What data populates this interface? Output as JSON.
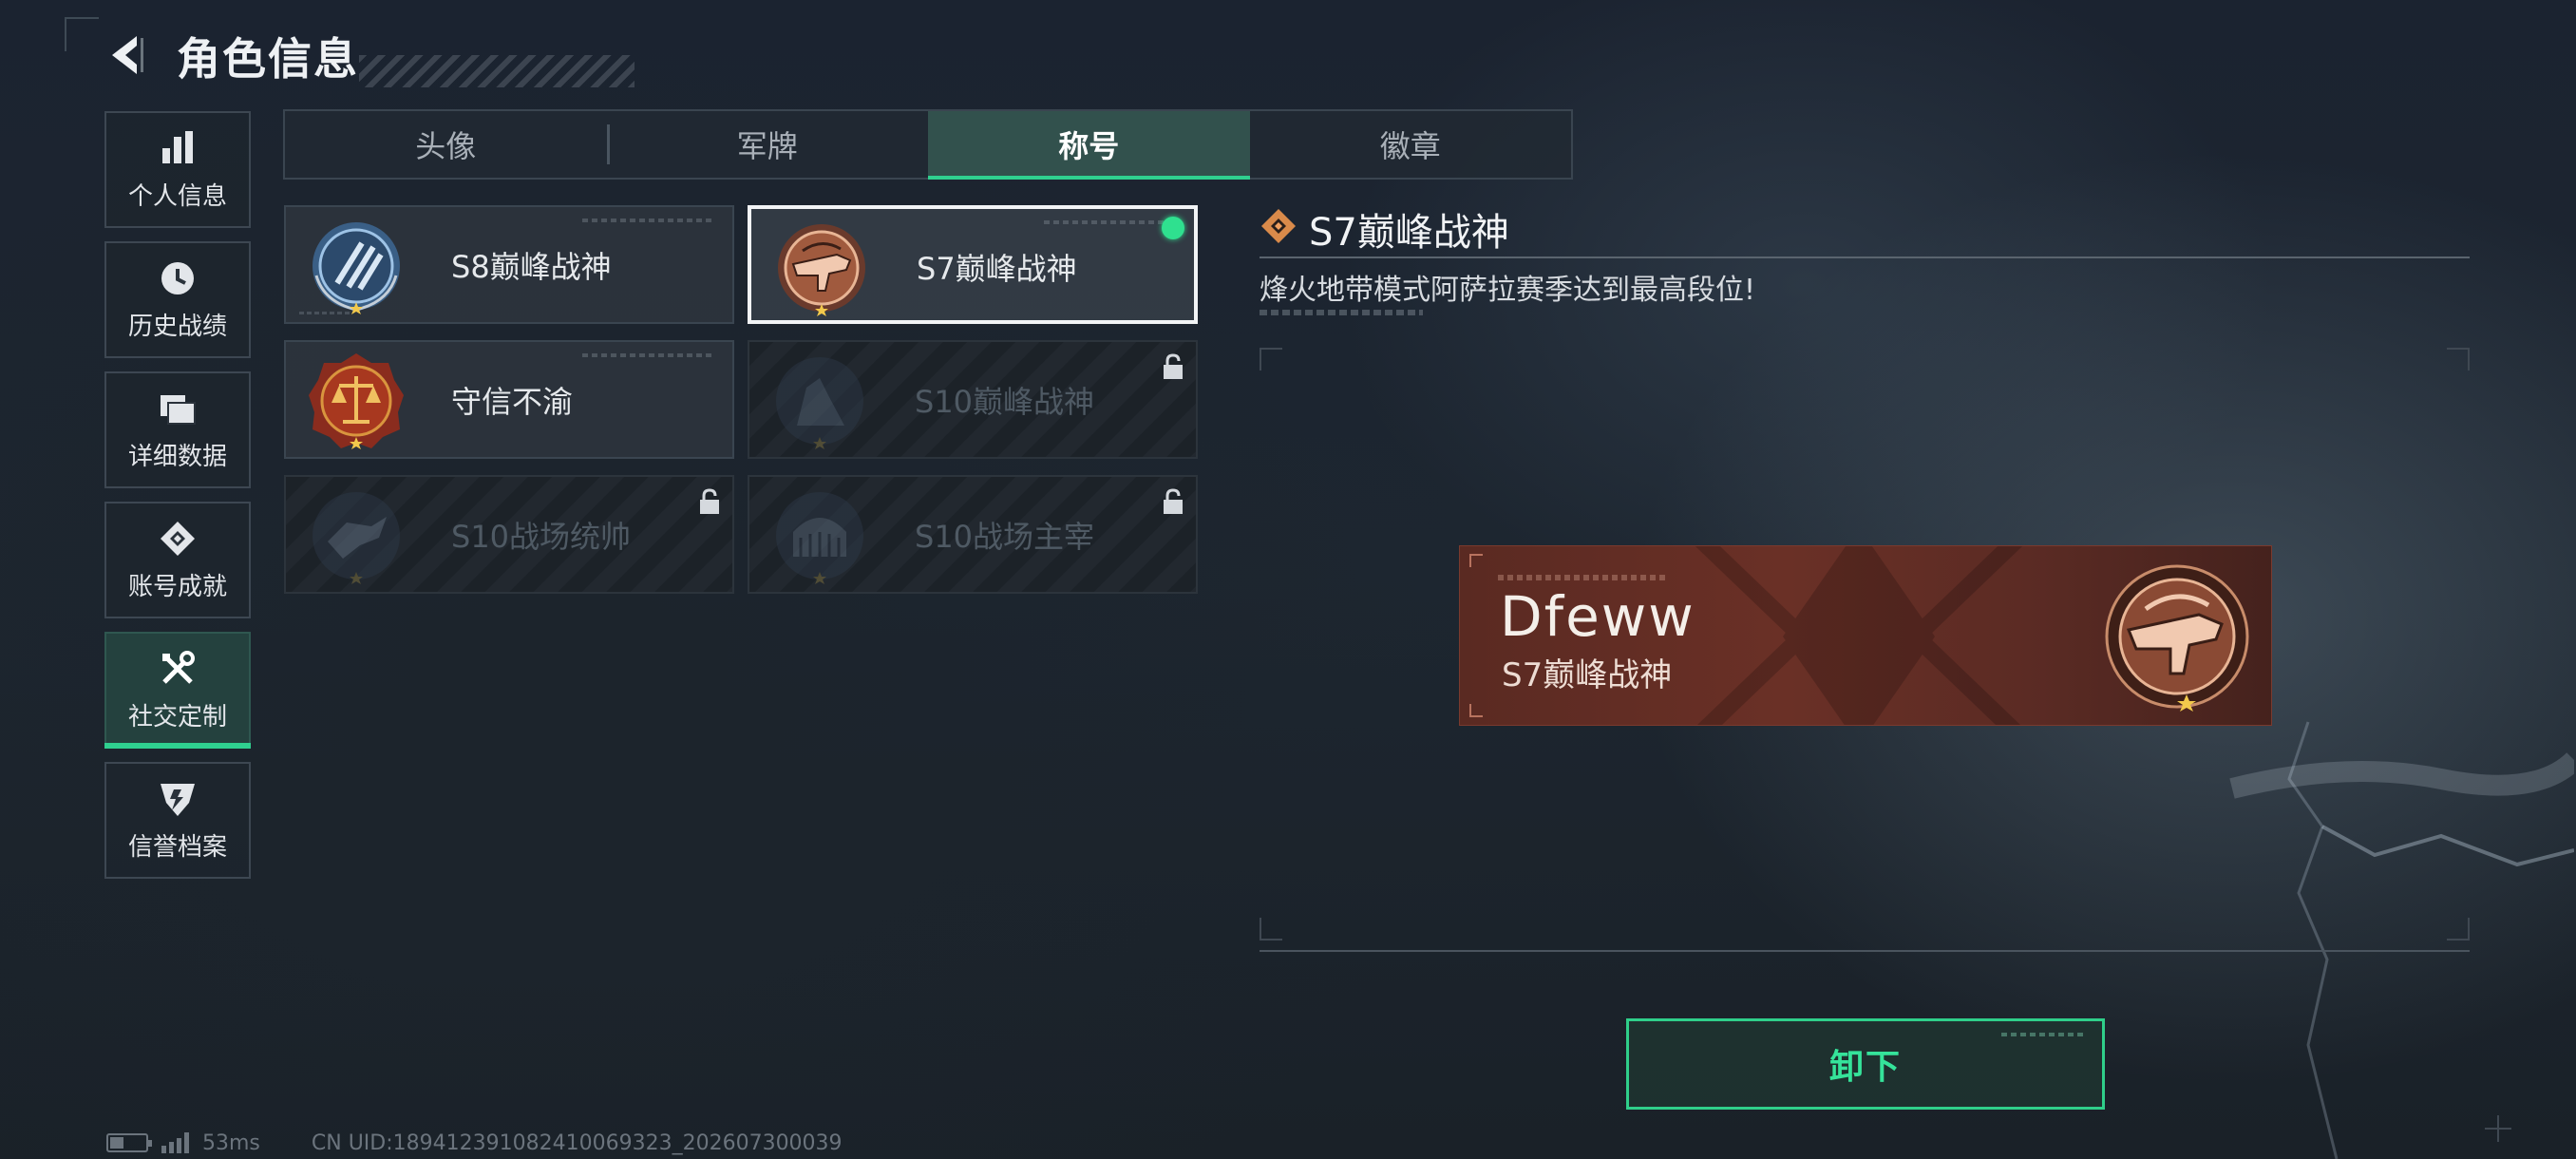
{
  "header": {
    "title": "角色信息"
  },
  "sidebar": {
    "items": [
      {
        "label": "个人信息",
        "icon": "bar-chart-icon",
        "active": false
      },
      {
        "label": "历史战绩",
        "icon": "clock-icon",
        "active": false
      },
      {
        "label": "详细数据",
        "icon": "folder-icon",
        "active": false
      },
      {
        "label": "账号成就",
        "icon": "achievement-icon",
        "active": false
      },
      {
        "label": "社交定制",
        "icon": "tools-icon",
        "active": true
      },
      {
        "label": "信誉档案",
        "icon": "credit-shield-icon",
        "active": false
      }
    ]
  },
  "tabs": [
    {
      "label": "头像",
      "active": false
    },
    {
      "label": "军牌",
      "active": false
    },
    {
      "label": "称号",
      "active": true
    },
    {
      "label": "徽章",
      "active": false
    }
  ],
  "titles": [
    {
      "name": "S8巅峰战神",
      "locked": false,
      "selected": false,
      "equipped": false,
      "badge": "s8-peak-badge-icon"
    },
    {
      "name": "S7巅峰战神",
      "locked": false,
      "selected": true,
      "equipped": true,
      "badge": "s7-peak-badge-icon"
    },
    {
      "name": "守信不渝",
      "locked": false,
      "selected": false,
      "equipped": false,
      "badge": "scales-badge-icon"
    },
    {
      "name": "S10巅峰战神",
      "locked": true,
      "selected": false,
      "equipped": false,
      "badge": "s10-peak-badge-icon"
    },
    {
      "name": "S10战场统帅",
      "locked": true,
      "selected": false,
      "equipped": false,
      "badge": "s10-commander-badge-icon"
    },
    {
      "name": "S10战场主宰",
      "locked": true,
      "selected": false,
      "equipped": false,
      "badge": "s10-dominator-badge-icon"
    }
  ],
  "detail": {
    "title": "S7巅峰战神",
    "description": "烽火地带模式阿萨拉赛季达到最高段位!"
  },
  "preview": {
    "player_name": "Dfeww",
    "title": "S7巅峰战神"
  },
  "actions": {
    "unequip_label": "卸下"
  },
  "status": {
    "ping": "53ms",
    "uid": "CN UID:18941239108241006​9323_202607300039"
  },
  "colors": {
    "accent": "#2fd08f",
    "preview_bg": "#6a3026"
  }
}
